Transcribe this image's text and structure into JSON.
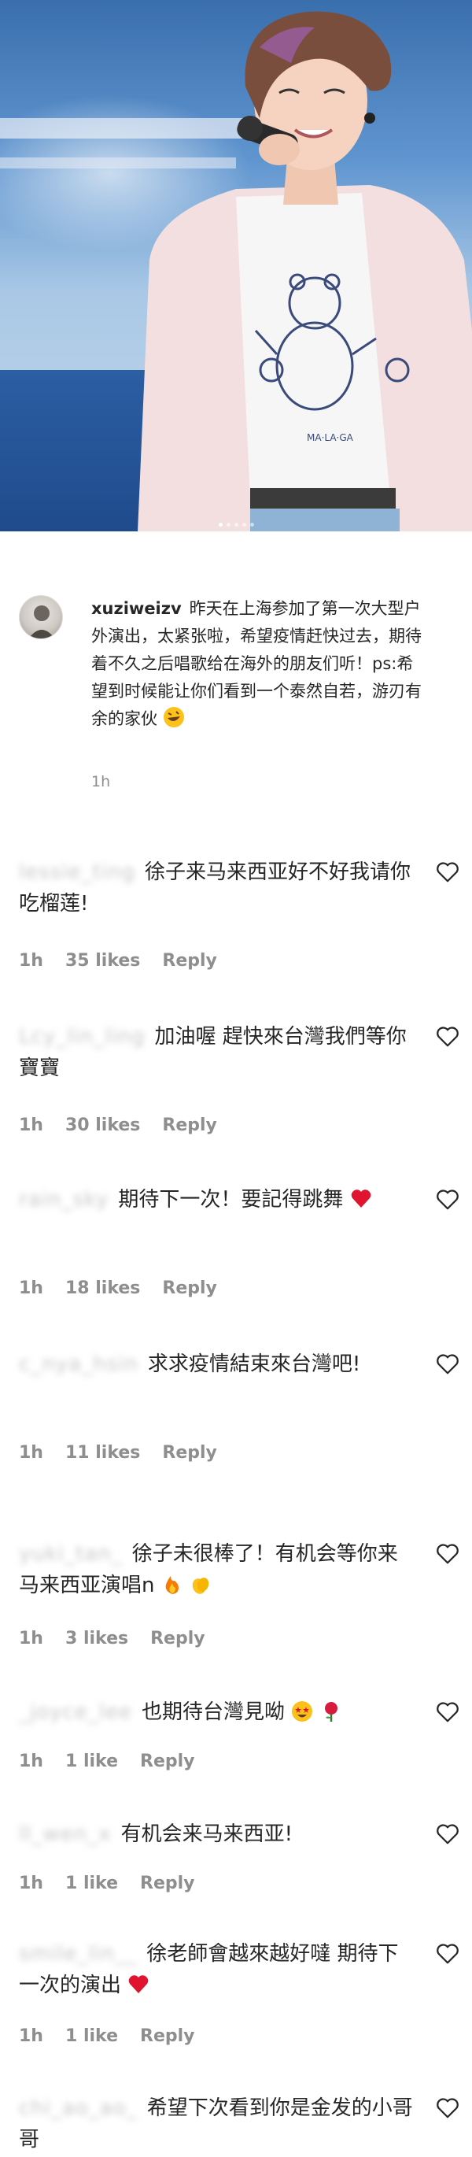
{
  "post": {
    "caption": {
      "username": "xuziweizv",
      "text": "昨天在上海参加了第一次大型户外演出，太紧张啦，希望疫情赶快过去，期待着不久之后唱歌给在海外的朋友们听！ps:希望到时候能让你们看到一个泰然自若，游刃有余的家伙",
      "time": "1h"
    },
    "carousel_dots": 5
  },
  "comments": [
    {
      "user": "lessie_ting",
      "text": "徐子来马来西亚好不好我请你吃榴莲!",
      "time": "1h",
      "likes": "35 likes",
      "reply": "Reply"
    },
    {
      "user": "Lcy_lin_ling",
      "text": "加油喔 趕快來台灣我們等你寶寶",
      "time": "1h",
      "likes": "30 likes",
      "reply": "Reply"
    },
    {
      "user": "rain_sky",
      "text": "期待下一次！要記得跳舞",
      "time": "1h",
      "likes": "18 likes",
      "reply": "Reply"
    },
    {
      "user": "c_nya_hsin",
      "text": "求求疫情結束來台灣吧!",
      "time": "1h",
      "likes": "11 likes",
      "reply": "Reply"
    },
    {
      "user": "yuki_tan_",
      "text": "徐子未很棒了！有机会等你来马来西亚演唱n",
      "time": "1h",
      "likes": "3 likes",
      "reply": "Reply"
    },
    {
      "user": "_joyce_lee",
      "text": "也期待台灣見呦",
      "time": "1h",
      "likes": "1 like",
      "reply": "Reply"
    },
    {
      "user": "ll_wen_x",
      "text": "有机会来马来西亚!",
      "time": "1h",
      "likes": "1 like",
      "reply": "Reply"
    },
    {
      "user": "smile_lin__",
      "text": "徐老師會越來越好噠 期待下一次的演出",
      "time": "1h",
      "likes": "1 like",
      "reply": "Reply"
    },
    {
      "user": "chi_ao_ao_",
      "text": "希望下次看到你是金发的小哥哥",
      "time": "",
      "likes": "",
      "reply": ""
    }
  ],
  "icons": {
    "heart": "heart-outline-icon",
    "emoji_rofl": "rolling-laughing-emoji",
    "emoji_heart": "red-heart-emoji",
    "emoji_fire": "fire-emoji",
    "emoji_clap": "clapping-hands-emoji",
    "emoji_starstruck": "star-struck-emoji",
    "emoji_rose": "rose-emoji",
    "emoji_scream": "screaming-face-emoji"
  }
}
